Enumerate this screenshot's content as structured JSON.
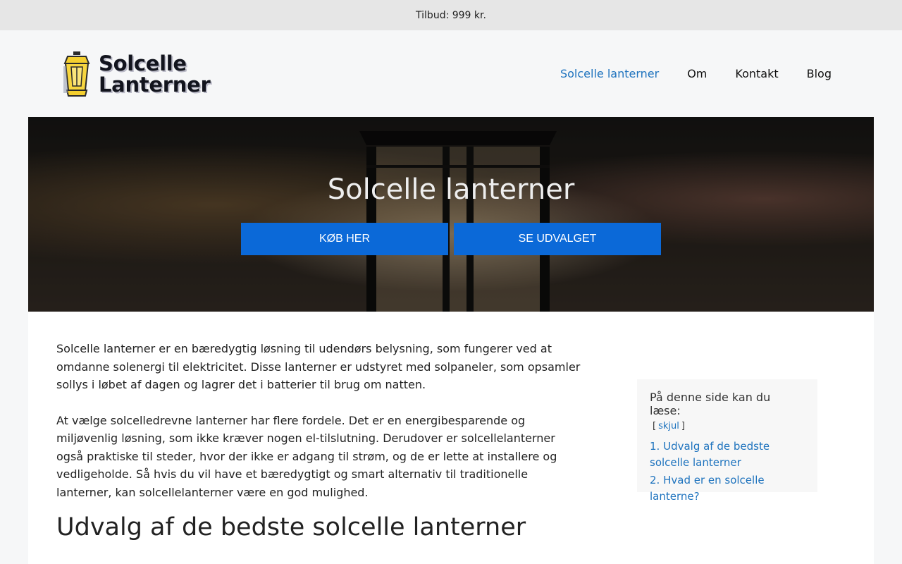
{
  "topbar": {
    "text": "Tilbud: 999 kr."
  },
  "logo": {
    "line1": "Solcelle",
    "line2": "Lanterner"
  },
  "nav": {
    "items": [
      {
        "label": "Solcelle lanterner"
      },
      {
        "label": "Om"
      },
      {
        "label": "Kontakt"
      },
      {
        "label": "Blog"
      }
    ]
  },
  "hero": {
    "title": "Solcelle lanterner",
    "buy_label": "KØB HER",
    "browse_label": "SE UDVALGET"
  },
  "article": {
    "p1": "Solcelle lanterner er en bæredygtig løsning til udendørs belysning, som fungerer ved at omdanne solenergi til elektricitet. Disse lanterner er udstyret med solpaneler, som opsamler sollys i løbet af dagen og lagrer det i batterier til brug om natten.",
    "p2": "At vælge solcelledrevne lanterner har flere fordele. Det er en energibesparende og miljøvenlig løsning, som ikke kræver nogen el-tilslutning. Derudover er solcellelanterner også praktiske til steder, hvor der ikke er adgang til strøm, og de er lette at installere og vedligeholde. Så hvis du vil have et bæredygtigt og smart alternativ til traditionelle lanterner, kan solcellelanterner være en god mulighed.",
    "h2": "Udvalg af de bedste solcelle lanterner"
  },
  "toc": {
    "title": "På denne side kan du læse:",
    "toggle": "skjul",
    "items": [
      {
        "num": "1.",
        "label": "Udvalg af de bedste solcelle lanterner"
      },
      {
        "num": "2.",
        "label": "Hvad er en solcelle lanterne?"
      }
    ]
  },
  "colors": {
    "accent": "#0b69d8",
    "link": "#1e73be"
  }
}
